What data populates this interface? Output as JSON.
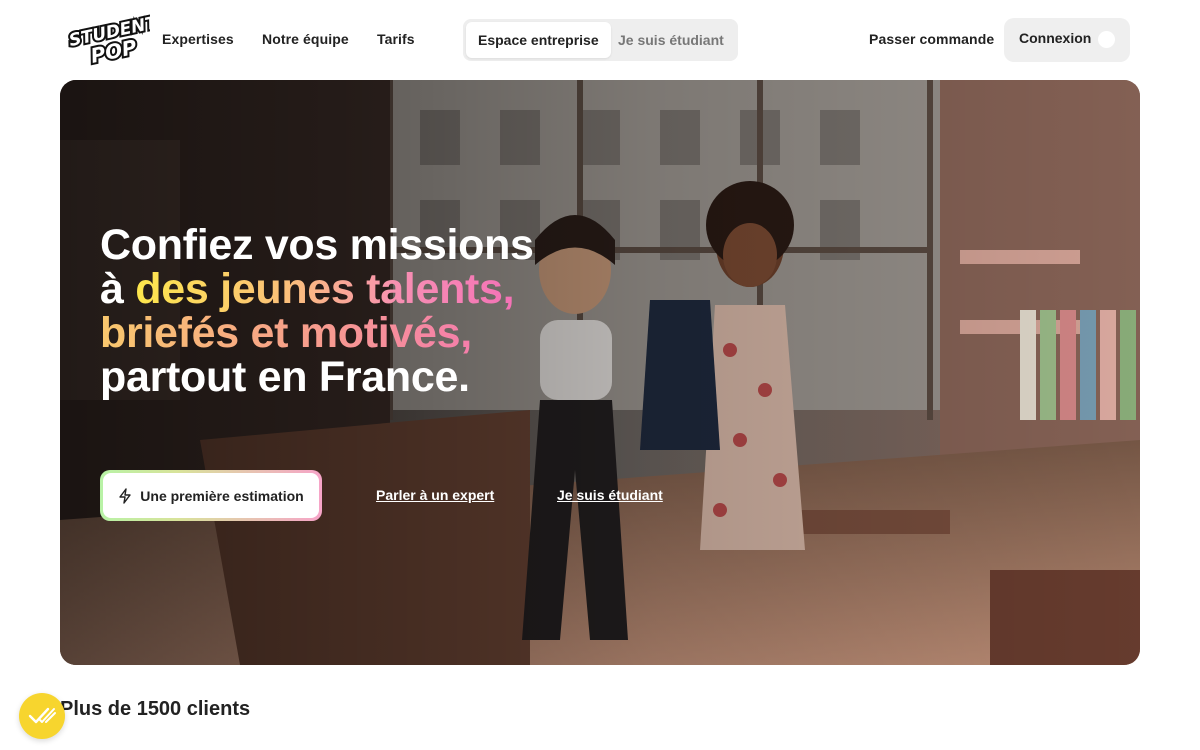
{
  "header": {
    "logo_text": [
      "STUDENT",
      "POP"
    ],
    "nav": [
      {
        "label": "Expertises"
      },
      {
        "label": "Notre équipe"
      },
      {
        "label": "Tarifs"
      }
    ],
    "switch": {
      "active_label": "Espace entreprise",
      "inactive_label": "Je suis étudiant"
    },
    "order_label": "Passer commande",
    "login_label": "Connexion"
  },
  "hero": {
    "title_line1": "Confiez vos missions",
    "title_line2_prefix": "à ",
    "title_line2_highlight": "des jeunes talents,",
    "title_line3_highlight": "briefés et motivés,",
    "title_line4": "partout en France.",
    "cta_label": "Une première estimation",
    "link_expert": "Parler à un expert",
    "link_student": "Je suis étudiant"
  },
  "footer_teaser": {
    "clients_text": "Plus de 1500 clients"
  },
  "icons": {
    "cta": "lightning-icon",
    "fab": "checkmarks-icon"
  },
  "colors": {
    "accent_yellow": "#f7d52e",
    "gradient_start": "#fde74c",
    "gradient_end": "#f472b6"
  }
}
